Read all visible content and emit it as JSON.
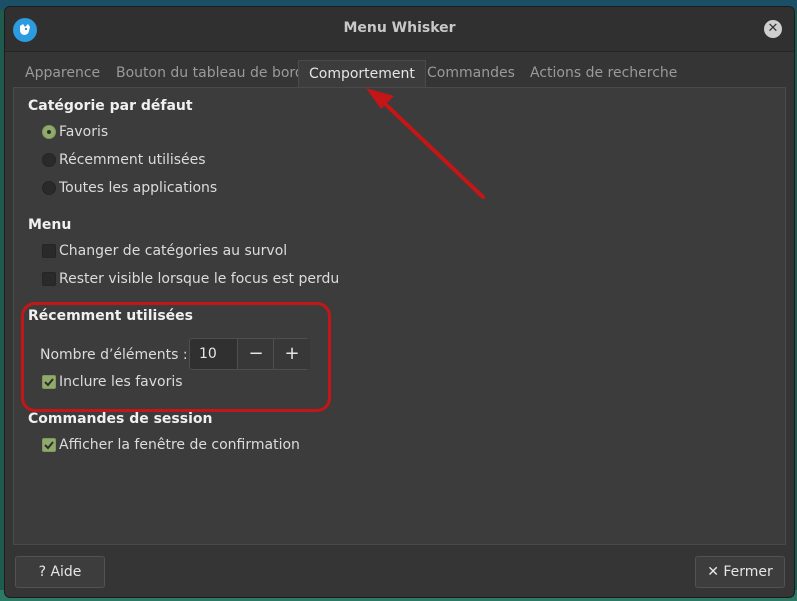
{
  "window": {
    "title": "Menu Whisker"
  },
  "tabs": [
    {
      "label": "Apparence"
    },
    {
      "label": "Bouton du tableau de bord"
    },
    {
      "label": "Comportement",
      "active": true
    },
    {
      "label": "Commandes"
    },
    {
      "label": "Actions de recherche"
    }
  ],
  "categorie": {
    "title": "Catégorie par défaut",
    "options": [
      {
        "label": "Favoris",
        "selected": true
      },
      {
        "label": "Récemment utilisées",
        "selected": false
      },
      {
        "label": "Toutes les applications",
        "selected": false
      }
    ]
  },
  "menu": {
    "title": "Menu",
    "options": [
      {
        "label": "Changer de catégories au survol",
        "checked": false
      },
      {
        "label": "Rester visible lorsque le focus est perdu",
        "checked": false
      }
    ]
  },
  "recent": {
    "title": "Récemment utilisées",
    "count_label": "Nombre d’éléments :",
    "count_value": "10",
    "decrement": "−",
    "increment": "+",
    "include_favorites": {
      "label": "Inclure les favoris",
      "checked": true
    }
  },
  "session": {
    "title": "Commandes de session",
    "confirm": {
      "label": "Afficher la fenêtre de confirmation",
      "checked": true
    }
  },
  "buttons": {
    "help": "? Aide",
    "close": "✕ Fermer"
  },
  "colors": {
    "accent": "#8faa6a",
    "annotation": "#c41616"
  }
}
